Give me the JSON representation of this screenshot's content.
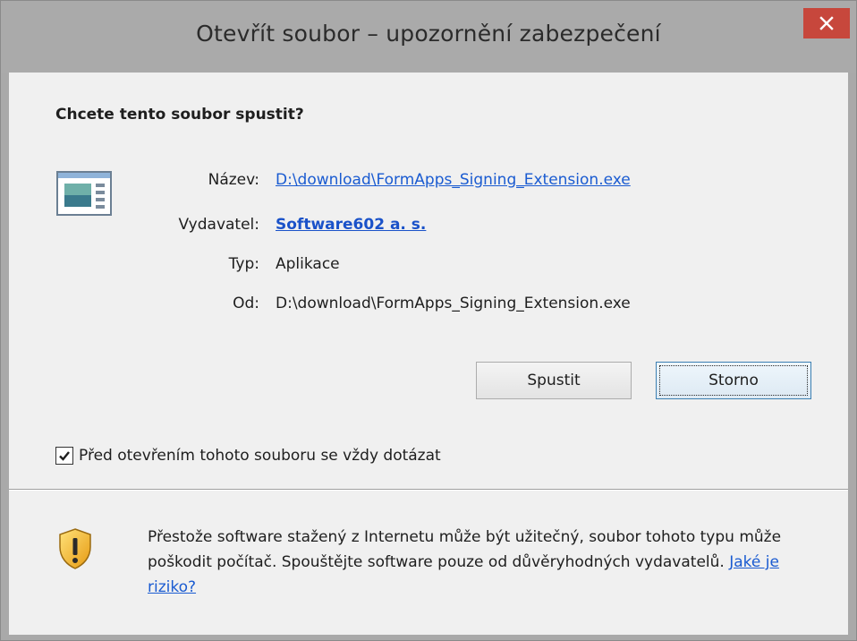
{
  "window": {
    "title": "Otevřít soubor – upozornění zabezpečení",
    "close_icon": "close-icon"
  },
  "dialog": {
    "question": "Chcete tento soubor spustit?",
    "fields": {
      "name_label": "Název:",
      "name_value": "D:\\download\\FormApps_Signing_Extension.exe",
      "publisher_label": "Vydavatel:",
      "publisher_value": "Software602 a. s.",
      "type_label": "Typ:",
      "type_value": "Aplikace",
      "from_label": "Od:",
      "from_value": "D:\\download\\FormApps_Signing_Extension.exe"
    },
    "buttons": {
      "run_label": "Spustit",
      "cancel_label": "Storno"
    },
    "checkbox": {
      "label": "Před otevřením tohoto souboru se vždy dotázat",
      "checked": true
    },
    "warning": {
      "text": "Přestože software stažený z Internetu může být užitečný, soubor tohoto typu může poškodit počítač. Spouštějte software pouze od důvěryhodných vydavatelů.",
      "link": "Jaké je riziko?"
    }
  },
  "colors": {
    "titlebar": "#aaaaaa",
    "close_button": "#c7473c",
    "link": "#1a5bd1",
    "client_background": "#f0f0f0"
  }
}
